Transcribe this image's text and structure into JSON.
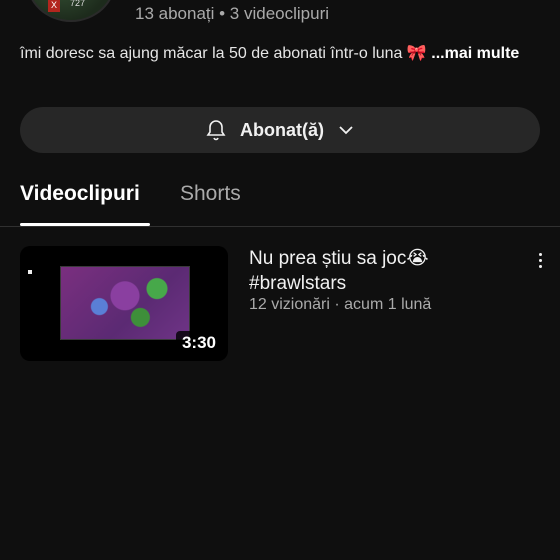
{
  "channel": {
    "avatar_icon": "channel-avatar",
    "avatar_badge": "X",
    "avatar_text": "727",
    "stats": "13 abonați • 3 videoclipuri",
    "description": "îmi doresc sa ajung măcar la 50 de abonati într-o luna 🎀",
    "more_label": "...mai multe"
  },
  "subscribe": {
    "bell_icon": "bell-icon",
    "label": "Abonat(ă)",
    "chevron_icon": "chevron-down-icon"
  },
  "tabs": [
    {
      "label": "Videoclipuri",
      "selected": true
    },
    {
      "label": "Shorts",
      "selected": false
    }
  ],
  "videos": [
    {
      "title": "Nu prea știu sa joc😭 #brawlstars",
      "meta": "12 vizionări · acum 1 lună",
      "duration": "3:30",
      "menu_icon": "more-vert-icon"
    }
  ],
  "colors": {
    "background": "#0f0f0f",
    "button_bg": "#272727",
    "secondary_text": "#aaaaaa"
  }
}
